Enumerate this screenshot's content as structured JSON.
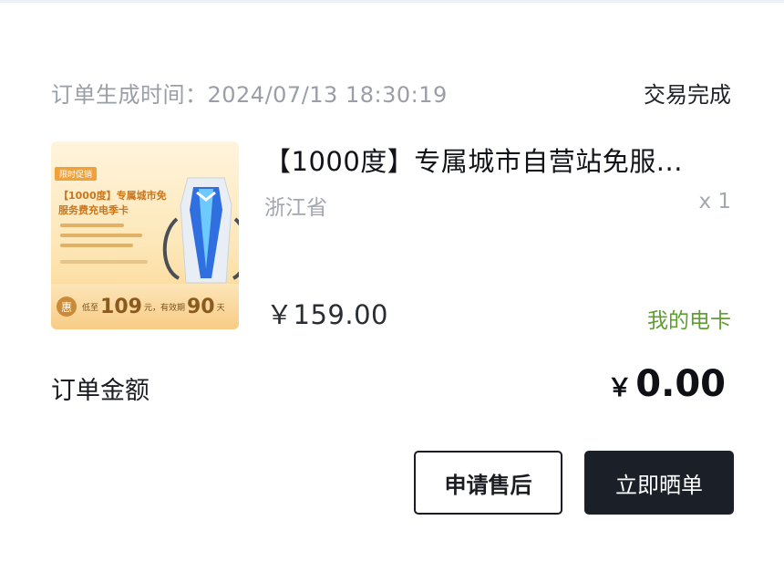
{
  "order": {
    "time_label": "订单生成时间：2024/07/13 18:30:19",
    "status": "交易完成"
  },
  "product": {
    "title": "【1000度】专属城市自营站免服...",
    "region": "浙江省",
    "quantity": "x 1",
    "price": "￥159.00",
    "card_link": "我的电卡",
    "thumbnail": {
      "promo_tag": "限时促销",
      "title": "【1000度】专属城市免服务费充电季卡",
      "footer_badge": "惠",
      "footer_prefix": "低至",
      "footer_price": "109",
      "footer_unit": "元，有效期",
      "footer_days": "90",
      "footer_days_unit": "天"
    }
  },
  "summary": {
    "amount_label": "订单金额",
    "amount_currency": "￥",
    "amount_value": "0.00"
  },
  "actions": {
    "after_sale_label": "申请售后",
    "share_label": "立即晒单"
  },
  "colors": {
    "accent_green": "#5f9e33",
    "dark_button": "#1b1f28",
    "muted_text": "#9a9ea6"
  }
}
